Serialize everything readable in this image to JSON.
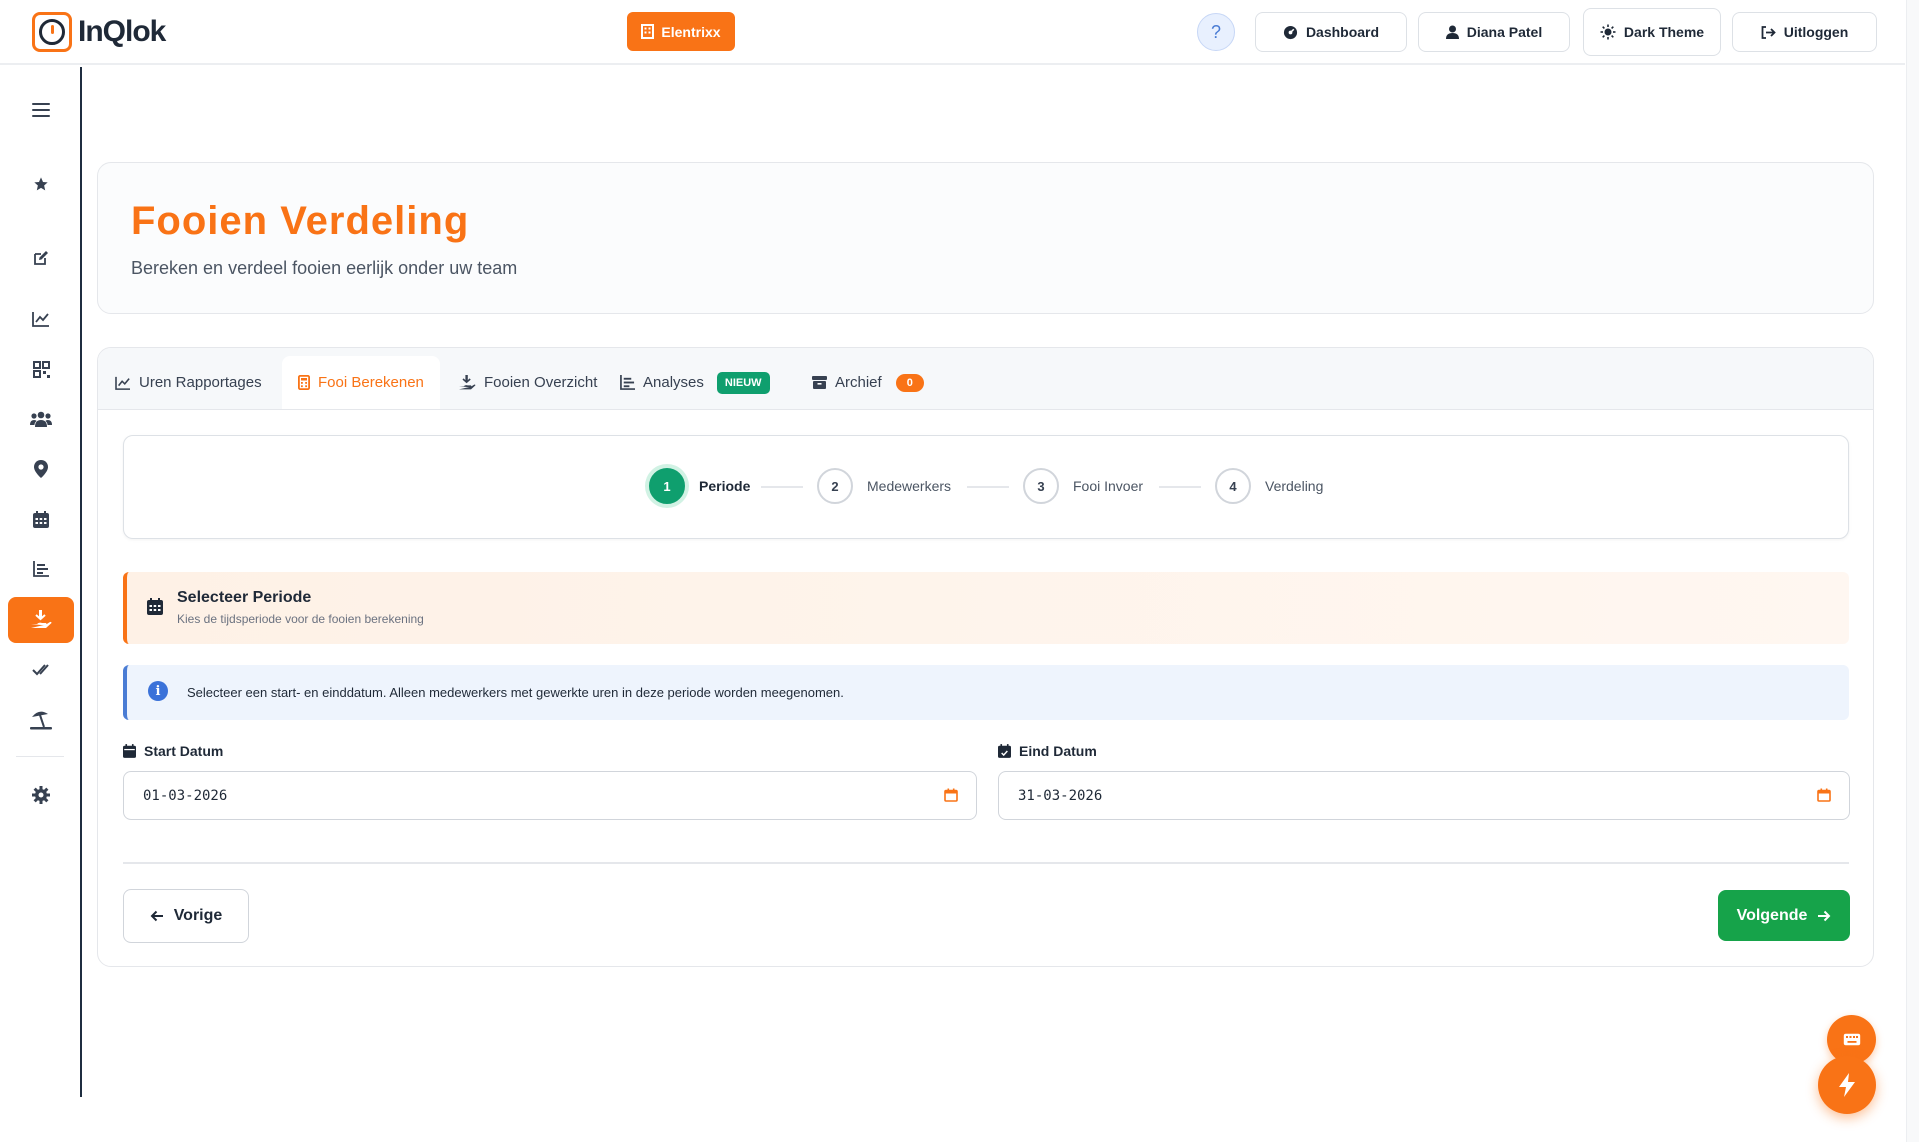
{
  "brand": {
    "name": "InQlok"
  },
  "header": {
    "company": "Elentrixx",
    "help": "?",
    "dashboard": "Dashboard",
    "user": "Diana Patel",
    "theme": "Dark Theme",
    "logout": "Uitloggen"
  },
  "page": {
    "title": "Fooien Verdeling",
    "subtitle": "Bereken en verdeel fooien eerlijk onder uw team"
  },
  "tabs": [
    {
      "label": "Uren Rapportages",
      "icon": "line-chart-icon"
    },
    {
      "label": "Fooi Berekenen",
      "icon": "calculator-icon",
      "active": true
    },
    {
      "label": "Fooien Overzicht",
      "icon": "hand-coins-icon"
    },
    {
      "label": "Analyses",
      "icon": "bar-list-icon",
      "badge": "NIEUW"
    },
    {
      "label": "Archief",
      "icon": "archive-icon",
      "count": "0"
    }
  ],
  "steps": [
    {
      "num": "1",
      "label": "Periode",
      "active": true
    },
    {
      "num": "2",
      "label": "Medewerkers"
    },
    {
      "num": "3",
      "label": "Fooi Invoer"
    },
    {
      "num": "4",
      "label": "Verdeling"
    }
  ],
  "section": {
    "title": "Selecteer Periode",
    "subtitle": "Kies de tijdsperiode voor de fooien berekening"
  },
  "info": {
    "icon": "i",
    "text": "Selecteer een start- en einddatum. Alleen medewerkers met gewerkte uren in deze periode worden meegenomen."
  },
  "form": {
    "start_label": "Start Datum",
    "start_value": "01-03-2026",
    "end_label": "Eind Datum",
    "end_value": "31-03-2026"
  },
  "buttons": {
    "prev": "Vorige",
    "next": "Volgende"
  },
  "colors": {
    "accent": "#f97316",
    "success": "#16a34a",
    "step_active": "#0f9f6e",
    "info": "#3b72d9"
  }
}
